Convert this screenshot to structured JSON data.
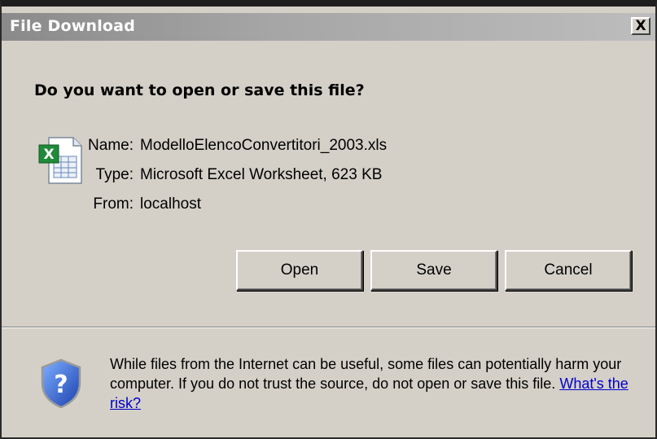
{
  "window": {
    "title": "File Download",
    "close_glyph": "X"
  },
  "dialog": {
    "question": "Do you want to open or save this file?",
    "file_icon": "excel-file-icon",
    "fields": [
      {
        "label": "Name:",
        "value": "ModelloElencoConvertitori_2003.xls"
      },
      {
        "label": "Type:",
        "value": "Microsoft Excel Worksheet, 623 KB"
      },
      {
        "label": "From:",
        "value": "localhost"
      }
    ],
    "buttons": {
      "open": "Open",
      "save": "Save",
      "cancel": "Cancel"
    }
  },
  "warning": {
    "icon": "security-shield-icon",
    "text": "While files from the Internet can be useful, some files can potentially harm your computer. If you do not trust the source, do not open or save this file.",
    "link": "What's the risk?"
  },
  "colors": {
    "dialog_bg": "#d4d0c8",
    "link": "#0000cc",
    "title_text": "#ffffff"
  }
}
